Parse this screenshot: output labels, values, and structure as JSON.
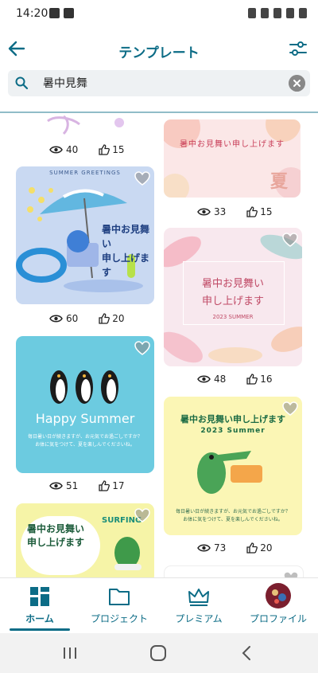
{
  "status_bar": {
    "time": "14:20"
  },
  "app_bar": {
    "title": "テンプレート"
  },
  "search": {
    "value": "暑中見舞"
  },
  "colors": {
    "accent": "#0c6c86"
  },
  "feed": {
    "left_cards": [
      {
        "id": "top-partial",
        "views": "40",
        "likes": "15"
      },
      {
        "id": "summer-blue",
        "header": "SUMMER GREETINGS",
        "line1": "暑中お見舞い",
        "line2": "申し上げます",
        "views": "60",
        "likes": "20"
      },
      {
        "id": "penguin",
        "title": "Happy Summer",
        "msg1": "毎日暑い日が続きますが、お元気でお過ごしですか？",
        "msg2": "お体に気をつけて、夏を楽しんでくださいね。",
        "views": "51",
        "likes": "17"
      },
      {
        "id": "surf",
        "line1": "暑中お見舞い",
        "line2": "申し上げます",
        "tag": "SURFING"
      }
    ],
    "right_cards": [
      {
        "id": "banner",
        "header": "暑中お見舞い申し上げます",
        "big": "夏",
        "views": "33",
        "likes": "15"
      },
      {
        "id": "leaf",
        "line1": "暑中お見舞い",
        "line2": "申し上げます",
        "year": "2023 SUMMER",
        "views": "48",
        "likes": "16"
      },
      {
        "id": "croc",
        "header": "暑中お見舞い申し上げます",
        "year": "2023 Summer",
        "msg1": "毎日暑い日が続きますが、お元気でお過ごしですか？",
        "msg2": "お体に気をつけて、夏を楽しんでくださいね。",
        "views": "73",
        "likes": "20"
      }
    ]
  },
  "bottom_nav": {
    "items": [
      {
        "label": "ホーム",
        "icon": "home-grid-icon",
        "active": true
      },
      {
        "label": "プロジェクト",
        "icon": "folder-icon",
        "active": false
      },
      {
        "label": "プレミアム",
        "icon": "crown-icon",
        "active": false
      },
      {
        "label": "プロファイル",
        "icon": "avatar",
        "active": false
      }
    ]
  }
}
